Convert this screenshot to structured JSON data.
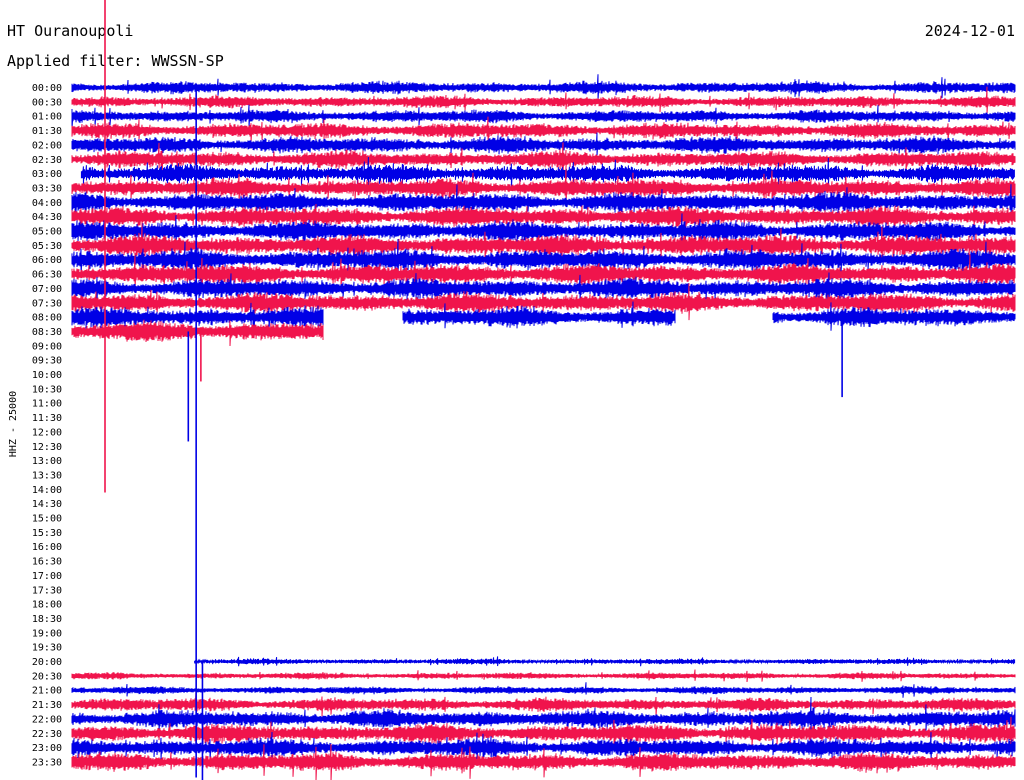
{
  "header": {
    "station": "HT Ouranoupoli",
    "date": "2024-12-01",
    "filter": "Applied filter: WWSSN-SP"
  },
  "chart_data": {
    "type": "line",
    "title": "HT Ouranoupoli",
    "date": "2024-12-01",
    "ylabel": "HHZ - 25000",
    "row_labels": [
      "00:00",
      "00:30",
      "01:00",
      "01:30",
      "02:00",
      "02:30",
      "03:00",
      "03:30",
      "04:00",
      "04:30",
      "05:00",
      "05:30",
      "06:00",
      "06:30",
      "07:00",
      "07:30",
      "08:00",
      "08:30",
      "09:00",
      "09:30",
      "10:00",
      "10:30",
      "11:00",
      "11:30",
      "12:00",
      "12:30",
      "13:00",
      "13:30",
      "14:00",
      "14:30",
      "15:00",
      "15:30",
      "16:00",
      "16:30",
      "17:00",
      "17:30",
      "18:00",
      "18:30",
      "19:00",
      "19:30",
      "20:00",
      "20:30",
      "21:00",
      "21:30",
      "22:00",
      "22:30",
      "23:00",
      "23:30"
    ],
    "x_range_minutes": [
      0,
      30
    ],
    "colors": [
      "#0000e6",
      "#f0144c"
    ],
    "rows": [
      {
        "start": 0,
        "end": 30,
        "amp": 0.55
      },
      {
        "start": 0,
        "end": 30,
        "amp": 0.55
      },
      {
        "start": 0,
        "end": 30,
        "amp": 0.6
      },
      {
        "start": 0,
        "end": 30,
        "amp": 0.7
      },
      {
        "start": 0,
        "end": 30,
        "amp": 0.75
      },
      {
        "start": 0,
        "end": 30,
        "amp": 0.75
      },
      {
        "start": 0.3,
        "end": 30,
        "amp": 0.8
      },
      {
        "start": 0,
        "end": 30,
        "amp": 0.85
      },
      {
        "start": 0,
        "end": 30,
        "amp": 0.9
      },
      {
        "start": 0,
        "end": 30,
        "amp": 0.9
      },
      {
        "start": 0,
        "end": 30,
        "amp": 0.9
      },
      {
        "start": 0,
        "end": 30,
        "amp": 0.95
      },
      {
        "start": 0,
        "end": 30,
        "amp": 0.95
      },
      {
        "start": 0,
        "end": 30,
        "amp": 0.95
      },
      {
        "start": 0,
        "end": 30,
        "amp": 0.9
      },
      {
        "start": 0,
        "end": 30,
        "amp": 0.9
      },
      {
        "start": 0,
        "end": 30,
        "amp": 0.9
      },
      {
        "start": 0,
        "end": 8.0,
        "amp": 0.95
      },
      {
        "start": 0,
        "end": 0,
        "amp": 0
      },
      {
        "start": 0,
        "end": 0,
        "amp": 0
      },
      {
        "start": 0,
        "end": 0,
        "amp": 0
      },
      {
        "start": 0,
        "end": 0,
        "amp": 0
      },
      {
        "start": 0,
        "end": 0,
        "amp": 0
      },
      {
        "start": 0,
        "end": 0,
        "amp": 0
      },
      {
        "start": 0,
        "end": 0,
        "amp": 0
      },
      {
        "start": 0,
        "end": 0,
        "amp": 0
      },
      {
        "start": 0,
        "end": 0,
        "amp": 0
      },
      {
        "start": 0,
        "end": 0,
        "amp": 0
      },
      {
        "start": 0,
        "end": 0,
        "amp": 0
      },
      {
        "start": 0,
        "end": 0,
        "amp": 0
      },
      {
        "start": 0,
        "end": 0,
        "amp": 0
      },
      {
        "start": 0,
        "end": 0,
        "amp": 0
      },
      {
        "start": 0,
        "end": 0,
        "amp": 0
      },
      {
        "start": 0,
        "end": 0,
        "amp": 0
      },
      {
        "start": 0,
        "end": 0,
        "amp": 0
      },
      {
        "start": 0,
        "end": 0,
        "amp": 0
      },
      {
        "start": 0,
        "end": 0,
        "amp": 0
      },
      {
        "start": 0,
        "end": 0,
        "amp": 0
      },
      {
        "start": 0,
        "end": 0,
        "amp": 0
      },
      {
        "start": 0,
        "end": 0,
        "amp": 0
      },
      {
        "start": 3.9,
        "end": 30,
        "amp": 0.25
      },
      {
        "start": 0,
        "end": 30,
        "amp": 0.3
      },
      {
        "start": 0,
        "end": 30,
        "amp": 0.35
      },
      {
        "start": 0,
        "end": 30,
        "amp": 0.6
      },
      {
        "start": 0,
        "end": 30,
        "amp": 0.8
      },
      {
        "start": 0,
        "end": 30,
        "amp": 0.85
      },
      {
        "start": 0,
        "end": 30,
        "amp": 0.85
      },
      {
        "start": 0,
        "end": 30,
        "amp": 0.85
      }
    ],
    "gaps": [
      {
        "row": 16,
        "start": 8.0,
        "end": 10.5
      },
      {
        "row": 16,
        "start": 19.2,
        "end": 22.3
      },
      {
        "row": 17,
        "start": 8.0,
        "end": 30
      }
    ],
    "spikes": [
      {
        "row": 0,
        "minute": 1.05,
        "up": 110,
        "down": 405,
        "color": "#f0144c"
      },
      {
        "row": 0,
        "minute": 3.95,
        "up": 0,
        "down": 690,
        "color": "#0000e6"
      },
      {
        "row": 17,
        "minute": 3.7,
        "up": 0,
        "down": 110,
        "color": "#0000e6"
      },
      {
        "row": 17,
        "minute": 4.1,
        "up": 0,
        "down": 50,
        "color": "#f0144c"
      },
      {
        "row": 16,
        "minute": 24.5,
        "up": 0,
        "down": 80,
        "color": "#0000e6"
      },
      {
        "row": 40,
        "minute": 4.15,
        "up": 0,
        "down": 120,
        "color": "#0000e6"
      }
    ],
    "grid": false
  }
}
